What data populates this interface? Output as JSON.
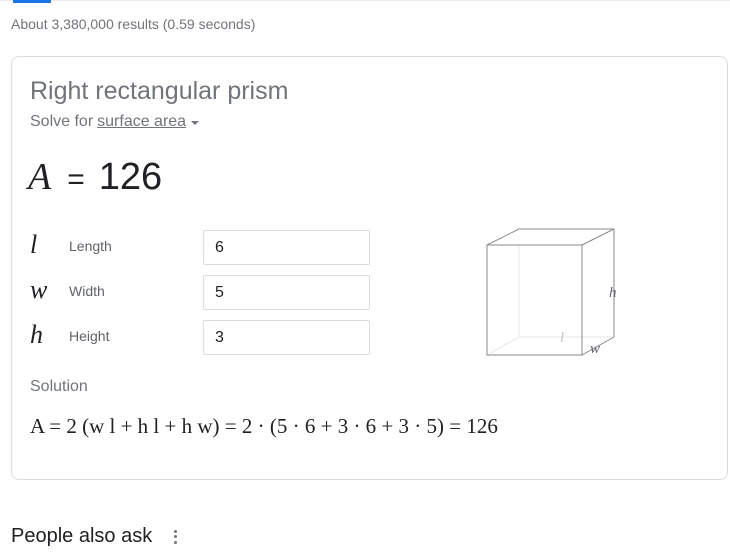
{
  "results": {
    "stats": "About 3,380,000 results (0.59 seconds)"
  },
  "calculator": {
    "title": "Right rectangular prism",
    "solve_for_prefix": "Solve for",
    "solve_for_value": "surface area",
    "result": {
      "variable": "A",
      "equals": "=",
      "value": "126"
    },
    "variables": [
      {
        "symbol": "l",
        "label": "Length",
        "value": "6"
      },
      {
        "symbol": "w",
        "label": "Width",
        "value": "5"
      },
      {
        "symbol": "h",
        "label": "Height",
        "value": "3"
      }
    ],
    "diagram": {
      "h_label": "h",
      "l_label": "l",
      "w_label": "w"
    },
    "solution_label": "Solution",
    "solution_formula": "A = 2 (w l + h l + h w) = 2 · (5 · 6 + 3 · 6 + 3 · 5) = 126"
  },
  "people_also_ask": {
    "title": "People also ask"
  },
  "colors": {
    "accent": "#1a73e8",
    "muted_text": "#70757a",
    "border": "#dadce0"
  },
  "icons": [
    "caret-down-icon",
    "more-vert-icon"
  ]
}
